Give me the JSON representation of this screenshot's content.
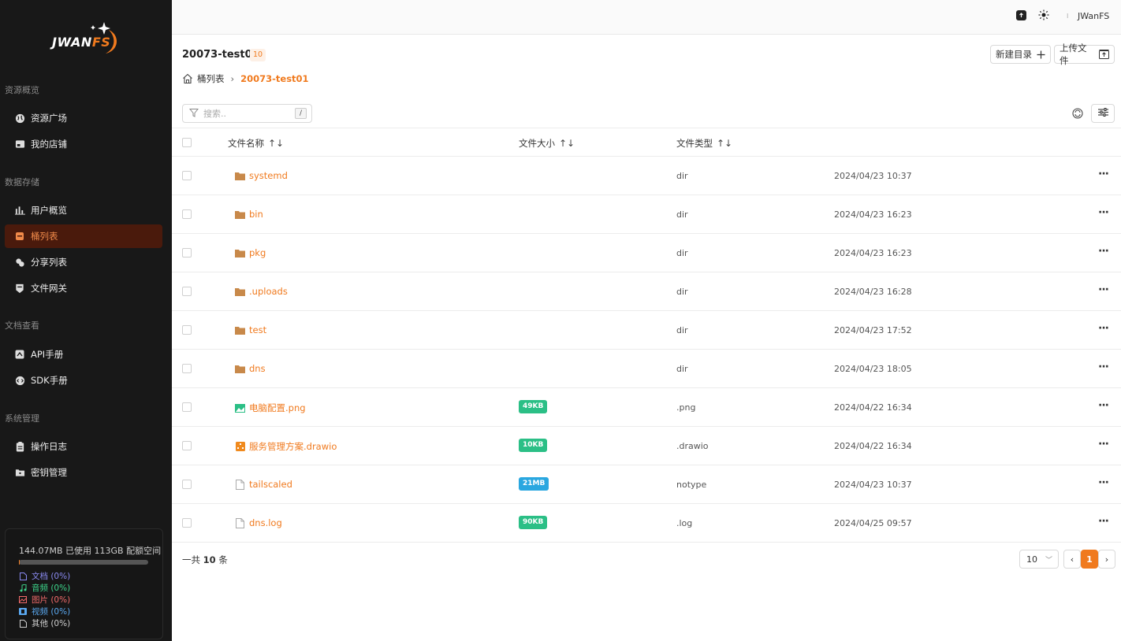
{
  "brand": {
    "logo_main": "JWAN",
    "logo_accent": "FS"
  },
  "sidebar": {
    "groups": [
      {
        "label": "资源概览"
      },
      {
        "label": "数据存储"
      },
      {
        "label": "文档查看"
      },
      {
        "label": "系统管理"
      }
    ],
    "items": [
      {
        "label": "资源广场",
        "icon": "globe-icon"
      },
      {
        "label": "我的店铺",
        "icon": "store-icon"
      },
      {
        "label": "用户概览",
        "icon": "bar-chart-icon"
      },
      {
        "label": "桶列表",
        "icon": "bucket-icon",
        "active": true
      },
      {
        "label": "分享列表",
        "icon": "share-icon"
      },
      {
        "label": "文件网关",
        "icon": "gateway-icon"
      },
      {
        "label": "API手册",
        "icon": "api-icon"
      },
      {
        "label": "SDK手册",
        "icon": "sdk-icon"
      },
      {
        "label": "操作日志",
        "icon": "clipboard-icon"
      },
      {
        "label": "密钥管理",
        "icon": "key-folder-icon"
      }
    ],
    "storage": {
      "summary": "144.07MB 已使用    113GB 配额空间",
      "used_fraction": 0.001,
      "legend": [
        {
          "label": "文档 (0%)",
          "color": "#8a8af0",
          "icon": "document-icon"
        },
        {
          "label": "音频 (0%)",
          "color": "#3dd68c",
          "icon": "music-icon"
        },
        {
          "label": "图片 (0%)",
          "color": "#f06a6a",
          "icon": "image-icon"
        },
        {
          "label": "视频 (0%)",
          "color": "#5aa8f0",
          "icon": "video-icon"
        },
        {
          "label": "其他 (0%)",
          "color": "#cfcfcf",
          "icon": "file-icon"
        }
      ]
    }
  },
  "topbar": {
    "user_initial": "I",
    "username": "JWanFS"
  },
  "main": {
    "bucket_name": "20073-test01",
    "bucket_count": "10",
    "new_dir_label": "新建目录",
    "upload_label": "上传文件",
    "breadcrumb": {
      "root": "桶列表",
      "current": "20073-test01"
    },
    "search": {
      "placeholder": "搜索..",
      "shortcut": "/"
    },
    "columns": {
      "name": "文件名称",
      "size": "文件大小",
      "type": "文件类型"
    },
    "sort_glyph": "↑↓",
    "rows": [
      {
        "name": "systemd",
        "kind": "folder",
        "size": "",
        "type": "dir",
        "date": "2024/04/23 10:37"
      },
      {
        "name": "bin",
        "kind": "folder",
        "size": "",
        "type": "dir",
        "date": "2024/04/23 16:23"
      },
      {
        "name": "pkg",
        "kind": "folder",
        "size": "",
        "type": "dir",
        "date": "2024/04/23 16:23"
      },
      {
        "name": ".uploads",
        "kind": "folder",
        "size": "",
        "type": "dir",
        "date": "2024/04/23 16:28"
      },
      {
        "name": "test",
        "kind": "folder",
        "size": "",
        "type": "dir",
        "date": "2024/04/23 17:52"
      },
      {
        "name": "dns",
        "kind": "folder",
        "size": "",
        "type": "dir",
        "date": "2024/04/23 18:05"
      },
      {
        "name": "电脑配置.png",
        "kind": "image",
        "size": "49KB",
        "size_color": "#2bbf86",
        "type": ".png",
        "date": "2024/04/22 16:34"
      },
      {
        "name": "服务管理方案.drawio",
        "kind": "drawio",
        "size": "10KB",
        "size_color": "#2bbf86",
        "type": ".drawio",
        "date": "2024/04/22 16:34"
      },
      {
        "name": "tailscaled",
        "kind": "file",
        "size": "21MB",
        "size_color": "#2aa7e0",
        "type": "notype",
        "date": "2024/04/23 10:37"
      },
      {
        "name": "dns.log",
        "kind": "file",
        "size": "90KB",
        "size_color": "#2bbf86",
        "type": ".log",
        "date": "2024/04/25 09:57"
      }
    ],
    "more_glyph": "···",
    "pagination": {
      "total_prefix": "一共",
      "total": "10",
      "total_suffix": "条",
      "page_size": "10",
      "current_page": "1"
    }
  },
  "colors": {
    "accent": "#f07a1e",
    "sidebar_bg": "#181818",
    "active_bg": "#4a1a0c"
  }
}
